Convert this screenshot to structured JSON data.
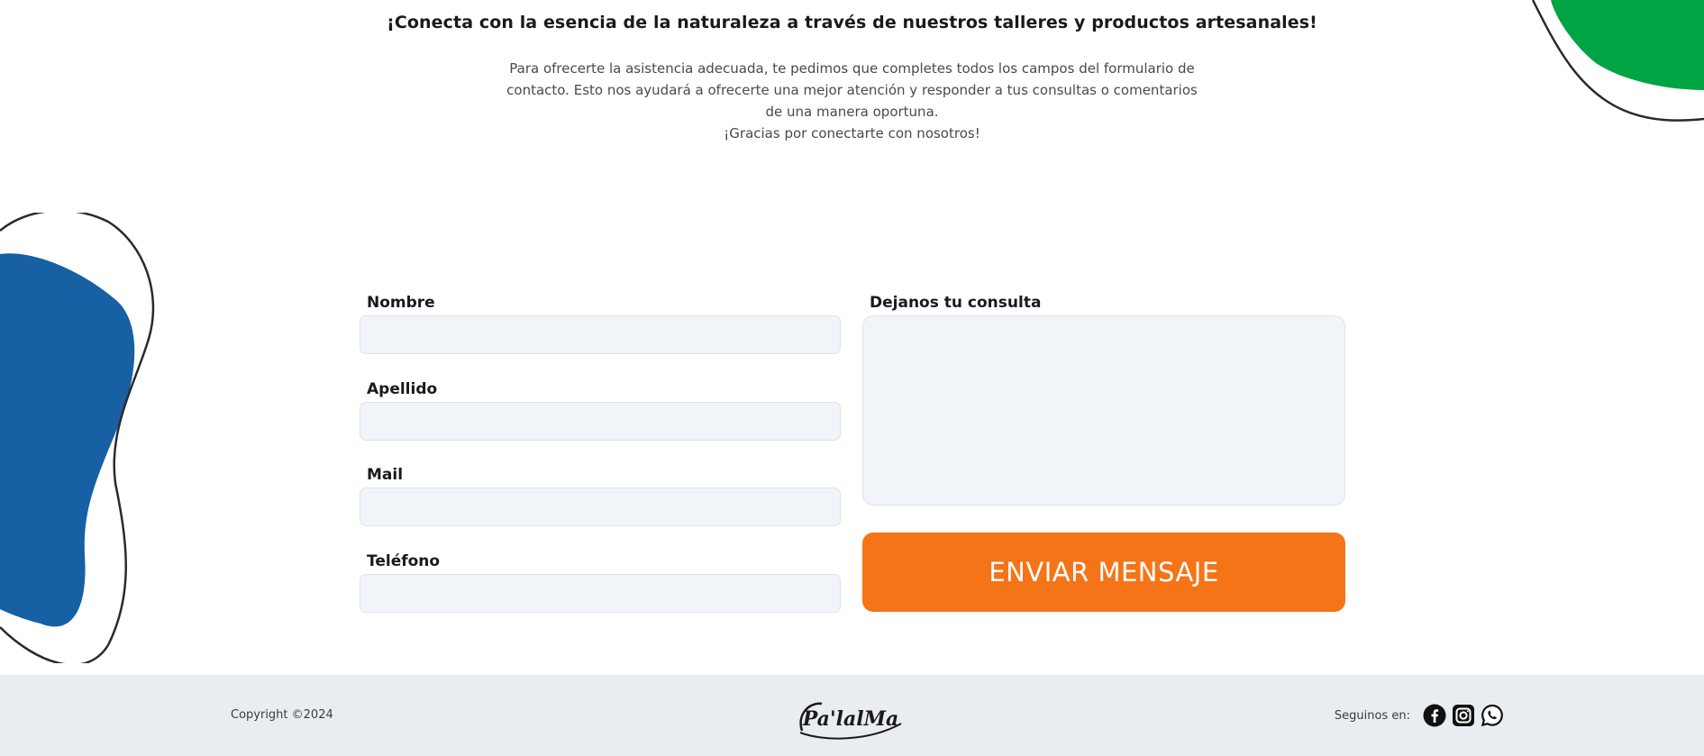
{
  "intro": {
    "title": "¡Conecta con la esencia de la naturaleza a través de nuestros talleres y productos artesanales!",
    "paragraph": "Para ofrecerte la asistencia adecuada, te pedimos que completes todos los campos del formulario de contacto. Esto nos ayudará a ofrecerte una mejor atención y responder a tus consultas o comentarios de una manera oportuna.",
    "thanks": "¡Gracias por conectarte con nosotros!"
  },
  "form": {
    "fields": [
      {
        "label": "Nombre",
        "value": "",
        "placeholder": ""
      },
      {
        "label": "Apellido",
        "value": "",
        "placeholder": ""
      },
      {
        "label": "Mail",
        "value": "",
        "placeholder": ""
      },
      {
        "label": "Teléfono",
        "value": "",
        "placeholder": ""
      }
    ],
    "message_label": "Dejanos tu consulta",
    "message_value": "",
    "submit_label": "ENVIAR MENSAJE"
  },
  "footer": {
    "copyright": "Copyright ©2024",
    "logo_text": "Pa'lalMa",
    "social_label": "Seguinos en:",
    "social_icons": [
      "facebook-icon",
      "instagram-icon",
      "whatsapp-icon"
    ]
  },
  "colors": {
    "accent_orange": "#f57418",
    "blob_blue": "#1660a3",
    "blob_green": "#00a443",
    "input_bg": "#f1f4f8",
    "footer_bg": "#e9edf2"
  }
}
